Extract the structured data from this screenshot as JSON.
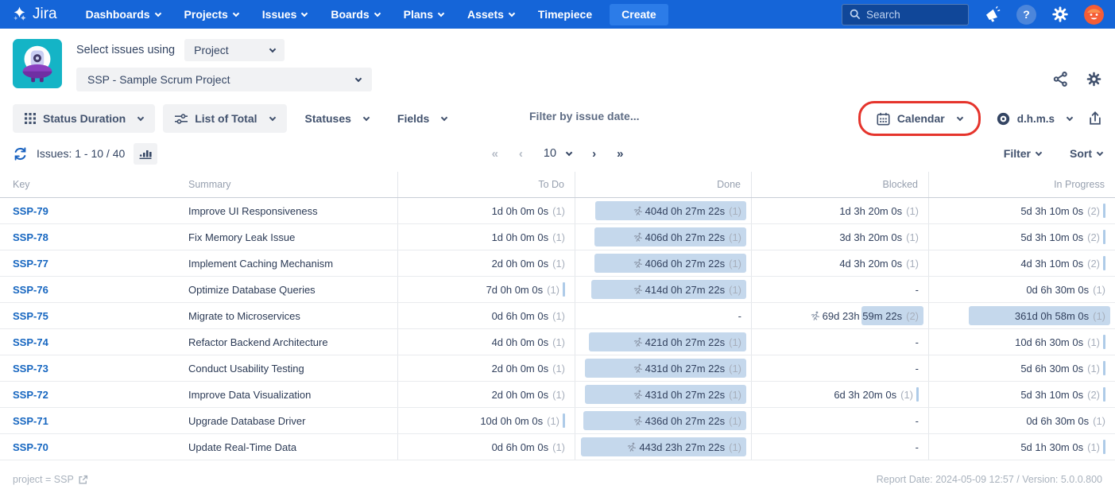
{
  "navbar": {
    "logo_text": "Jira",
    "items": [
      {
        "label": "Dashboards",
        "chevron": true
      },
      {
        "label": "Projects",
        "chevron": true
      },
      {
        "label": "Issues",
        "chevron": true
      },
      {
        "label": "Boards",
        "chevron": true
      },
      {
        "label": "Plans",
        "chevron": true
      },
      {
        "label": "Assets",
        "chevron": true
      },
      {
        "label": "Timepiece",
        "chevron": false
      }
    ],
    "create_label": "Create",
    "search_placeholder": "Search"
  },
  "header": {
    "select_label": "Select issues using",
    "mode_value": "Project",
    "project_value": "SSP - Sample Scrum Project"
  },
  "toolbar": {
    "report_type": "Status Duration",
    "view_mode": "List of Total",
    "statuses_label": "Statuses",
    "fields_label": "Fields",
    "date_filter_placeholder": "Filter by issue date...",
    "calendar_label": "Calendar",
    "format_label": "d.h.m.s"
  },
  "pagination": {
    "issues_label": "Issues: 1 - 10 / 40",
    "first": "«",
    "prev": "‹",
    "page_size": "10",
    "next": "›",
    "last": "»",
    "filter_label": "Filter",
    "sort_label": "Sort"
  },
  "icons": {
    "search": "magnifier",
    "announcement": "megaphone",
    "help": "question-circle",
    "settings": "gear",
    "share": "share-nodes",
    "export": "upload-box",
    "calendar": "calendar",
    "format": "clock-bullseye",
    "refresh": "refresh-arrows",
    "chart": "bar-chart",
    "external_link": "external-link",
    "running": "runner",
    "report_type": "grid-dots",
    "view_mode": "sliders"
  },
  "colors": {
    "navbar": "#1565D8",
    "create_button": "#2C7CE8",
    "highlight_red": "#E5342C",
    "duration_pill": "#C5D8EC",
    "issue_link": "#1666C0",
    "app_icon_teal": "#14B4C6"
  },
  "table": {
    "columns": [
      "Key",
      "Summary",
      "To Do",
      "Done",
      "Blocked",
      "In Progress"
    ],
    "rows": [
      {
        "key": "SSP-79",
        "summary": "Improve UI Responsiveness",
        "todo": {
          "value": "1d 0h 0m 0s",
          "count": "(1)"
        },
        "done": {
          "value": "404d 0h 27m 22s",
          "count": "(1)",
          "pill": 190,
          "running": true
        },
        "blocked": {
          "value": "1d 3h 20m 0s",
          "count": "(1)"
        },
        "inprogress": {
          "value": "5d 3h 10m 0s",
          "count": "(2)",
          "bar": true
        }
      },
      {
        "key": "SSP-78",
        "summary": "Fix Memory Leak Issue",
        "todo": {
          "value": "1d 0h 0m 0s",
          "count": "(1)"
        },
        "done": {
          "value": "406d 0h 27m 22s",
          "count": "(1)",
          "pill": 191,
          "running": true
        },
        "blocked": {
          "value": "3d 3h 20m 0s",
          "count": "(1)"
        },
        "inprogress": {
          "value": "5d 3h 10m 0s",
          "count": "(2)",
          "bar": true
        }
      },
      {
        "key": "SSP-77",
        "summary": "Implement Caching Mechanism",
        "todo": {
          "value": "2d 0h 0m 0s",
          "count": "(1)"
        },
        "done": {
          "value": "406d 0h 27m 22s",
          "count": "(1)",
          "pill": 191,
          "running": true
        },
        "blocked": {
          "value": "4d 3h 20m 0s",
          "count": "(1)"
        },
        "inprogress": {
          "value": "4d 3h 10m 0s",
          "count": "(2)",
          "bar": true
        }
      },
      {
        "key": "SSP-76",
        "summary": "Optimize Database Queries",
        "todo": {
          "value": "7d 0h 0m 0s",
          "count": "(1)",
          "bar": true
        },
        "done": {
          "value": "414d 0h 27m 22s",
          "count": "(1)",
          "pill": 195,
          "running": true
        },
        "blocked": {
          "value": "-"
        },
        "inprogress": {
          "value": "0d 6h 30m 0s",
          "count": "(1)"
        }
      },
      {
        "key": "SSP-75",
        "summary": "Migrate to Microservices",
        "todo": {
          "value": "0d 6h 0m 0s",
          "count": "(1)"
        },
        "done": {
          "value": "-"
        },
        "blocked": {
          "value": "69d 23h 59m 22s",
          "count": "(2)",
          "pill": 78,
          "running": true
        },
        "inprogress": {
          "value": "361d 0h 58m 0s",
          "count": "(1)",
          "pill": 178
        }
      },
      {
        "key": "SSP-74",
        "summary": "Refactor Backend Architecture",
        "todo": {
          "value": "4d 0h 0m 0s",
          "count": "(1)"
        },
        "done": {
          "value": "421d 0h 27m 22s",
          "count": "(1)",
          "pill": 198,
          "running": true
        },
        "blocked": {
          "value": "-"
        },
        "inprogress": {
          "value": "10d 6h 30m 0s",
          "count": "(1)",
          "bar": true
        }
      },
      {
        "key": "SSP-73",
        "summary": "Conduct Usability Testing",
        "todo": {
          "value": "2d 0h 0m 0s",
          "count": "(1)"
        },
        "done": {
          "value": "431d 0h 27m 22s",
          "count": "(1)",
          "pill": 203,
          "running": true
        },
        "blocked": {
          "value": "-"
        },
        "inprogress": {
          "value": "5d 6h 30m 0s",
          "count": "(1)",
          "bar": true
        }
      },
      {
        "key": "SSP-72",
        "summary": "Improve Data Visualization",
        "todo": {
          "value": "2d 0h 0m 0s",
          "count": "(1)"
        },
        "done": {
          "value": "431d 0h 27m 22s",
          "count": "(1)",
          "pill": 203,
          "running": true
        },
        "blocked": {
          "value": "6d 3h 20m 0s",
          "count": "(1)",
          "bar": true
        },
        "inprogress": {
          "value": "5d 3h 10m 0s",
          "count": "(2)",
          "bar": true
        }
      },
      {
        "key": "SSP-71",
        "summary": "Upgrade Database Driver",
        "todo": {
          "value": "10d 0h 0m 0s",
          "count": "(1)",
          "bar": true
        },
        "done": {
          "value": "436d 0h 27m 22s",
          "count": "(1)",
          "pill": 205,
          "running": true
        },
        "blocked": {
          "value": "-"
        },
        "inprogress": {
          "value": "0d 6h 30m 0s",
          "count": "(1)"
        }
      },
      {
        "key": "SSP-70",
        "summary": "Update Real-Time Data",
        "todo": {
          "value": "0d 6h 0m 0s",
          "count": "(1)"
        },
        "done": {
          "value": "443d 23h 27m 22s",
          "count": "(1)",
          "pill": 208,
          "running": true
        },
        "blocked": {
          "value": "-"
        },
        "inprogress": {
          "value": "5d 1h 30m 0s",
          "count": "(1)",
          "bar": true
        }
      }
    ]
  },
  "footer": {
    "query": "project = SSP",
    "report_info": "Report Date: 2024-05-09 12:57 / Version: 5.0.0.800"
  }
}
